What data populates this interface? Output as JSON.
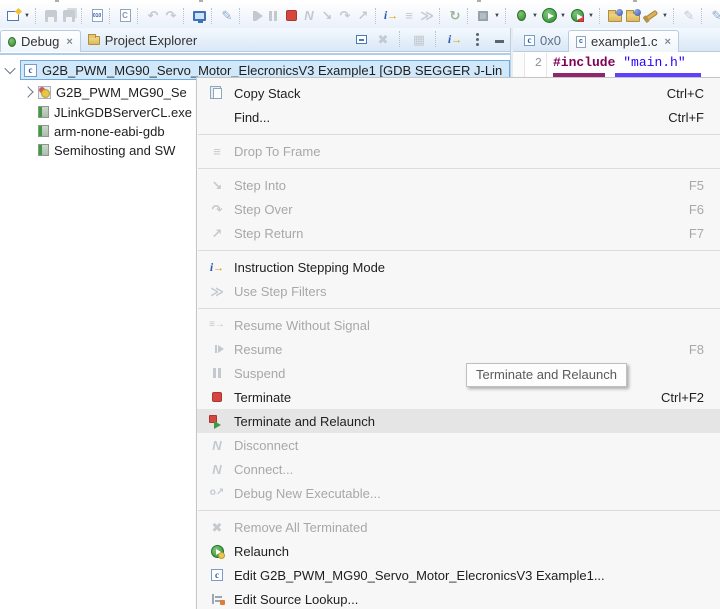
{
  "glyphs": {
    "caret": "▼",
    "undo": "↶",
    "redo": "↷",
    "pencil": "✎",
    "step_into": "↘",
    "step_over": "↷",
    "step_return": "↗",
    "ism_i": "i",
    "ism_arrow": "→",
    "drop_frame": "≡",
    "filters": "≫",
    "refresh": "↻",
    "disconnect": "N",
    "connect": "N",
    "debug_new": "o↗",
    "remove_all": "✖",
    "resume_signal": "≡→",
    "grid": "▦",
    "close": "×",
    "c_letter": "c",
    "binary": "010",
    "c_file": "C"
  },
  "left_tabs": [
    {
      "label": "Debug"
    },
    {
      "label": "Project Explorer"
    }
  ],
  "debug_tree": [
    {
      "label": "G2B_PWM_MG90_Servo_Motor_ElecronicsV3 Example1 [GDB SEGGER J-Lin",
      "selected": true
    },
    {
      "label": "G2B_PWM_MG90_Se"
    },
    {
      "label": "JLinkGDBServerCL.exe"
    },
    {
      "label": "arm-none-eabi-gdb"
    },
    {
      "label": "Semihosting and SW"
    }
  ],
  "editor": {
    "tabs": [
      {
        "label": "0x0"
      },
      {
        "label": "example1.c",
        "active": true
      }
    ],
    "line_no": "2",
    "code_directive": "#include",
    "code_string": "\"main.h\""
  },
  "menu": {
    "items": [
      {
        "label": "Copy Stack",
        "shortcut": "Ctrl+C",
        "enabled": true
      },
      {
        "label": "Find...",
        "shortcut": "Ctrl+F",
        "enabled": true
      },
      {
        "label": "Drop To Frame",
        "shortcut": "",
        "enabled": false
      },
      {
        "label": "Step Into",
        "shortcut": "F5",
        "enabled": false
      },
      {
        "label": "Step Over",
        "shortcut": "F6",
        "enabled": false
      },
      {
        "label": "Step Return",
        "shortcut": "F7",
        "enabled": false
      },
      {
        "label": "Instruction Stepping Mode",
        "shortcut": "",
        "enabled": true
      },
      {
        "label": "Use Step Filters",
        "shortcut": "",
        "enabled": false
      },
      {
        "label": "Resume Without Signal",
        "shortcut": "",
        "enabled": false
      },
      {
        "label": "Resume",
        "shortcut": "F8",
        "enabled": false
      },
      {
        "label": "Suspend",
        "shortcut": "",
        "enabled": false
      },
      {
        "label": "Terminate",
        "shortcut": "Ctrl+F2",
        "enabled": true
      },
      {
        "label": "Terminate and Relaunch",
        "shortcut": "",
        "enabled": true,
        "hover": true
      },
      {
        "label": "Disconnect",
        "shortcut": "",
        "enabled": false
      },
      {
        "label": "Connect...",
        "shortcut": "",
        "enabled": false
      },
      {
        "label": "Debug New Executable...",
        "shortcut": "",
        "enabled": false
      },
      {
        "label": "Remove All Terminated",
        "shortcut": "",
        "enabled": false
      },
      {
        "label": "Relaunch",
        "shortcut": "",
        "enabled": true
      },
      {
        "label": "Edit G2B_PWM_MG90_Servo_Motor_ElecronicsV3 Example1...",
        "shortcut": "",
        "enabled": true
      },
      {
        "label": "Edit Source Lookup...",
        "shortcut": "",
        "enabled": true
      }
    ]
  },
  "tooltip": {
    "text": "Terminate and Relaunch"
  },
  "colors": {
    "accent_blue": "#3875b8",
    "selection_fill": "#d0e8fa",
    "terminate_red": "#d8453e",
    "run_green": "#2f8d33",
    "directive_maroon": "#7f0055",
    "string_blue": "#2a00ff"
  }
}
